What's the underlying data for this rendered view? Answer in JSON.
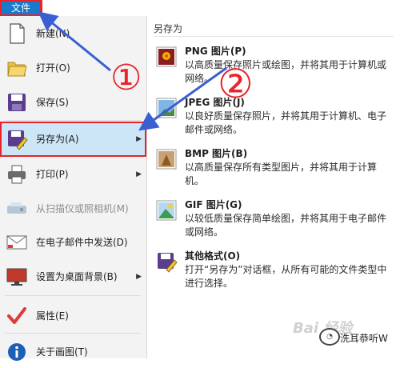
{
  "file_tab": {
    "label": "文件"
  },
  "menu": {
    "items": [
      {
        "label": "新建(N)",
        "icon": "new-document-icon"
      },
      {
        "label": "打开(O)",
        "icon": "open-folder-icon"
      },
      {
        "label": "保存(S)",
        "icon": "save-disk-icon"
      },
      {
        "label": "另存为(A)",
        "icon": "save-as-icon",
        "has_submenu": true,
        "active": true
      },
      {
        "label": "打印(P)",
        "icon": "printer-icon",
        "has_submenu": true
      },
      {
        "label": "从扫描仪或照相机(M)",
        "icon": "scanner-icon",
        "disabled": true
      },
      {
        "label": "在电子邮件中发送(D)",
        "icon": "email-icon"
      },
      {
        "label": "设置为桌面背景(B)",
        "icon": "desktop-background-icon",
        "has_submenu": true
      },
      {
        "label": "属性(E)",
        "icon": "checkmark-icon"
      },
      {
        "label": "关于画图(T)",
        "icon": "about-icon"
      }
    ],
    "submenu_arrow": "▶"
  },
  "save_as_panel": {
    "header": "另存为",
    "formats": [
      {
        "title": "PNG 图片(P)",
        "desc": "以高质量保存照片或绘图，并将其用于计算机或网络。",
        "icon": "png-image-icon"
      },
      {
        "title": "JPEG 图片(J)",
        "desc": "以良好质量保存照片，并将其用于计算机、电子邮件或网络。",
        "icon": "jpeg-image-icon"
      },
      {
        "title": "BMP 图片(B)",
        "desc": "以高质量保存所有类型图片，并将其用于计算机。",
        "icon": "bmp-image-icon"
      },
      {
        "title": "GIF 图片(G)",
        "desc": "以较低质量保存简单绘图，并将其用于电子邮件或网络。",
        "icon": "gif-image-icon"
      },
      {
        "title": "其他格式(O)",
        "desc": "打开“另存为”对话框，从所有可能的文件类型中进行选择。",
        "icon": "other-formats-icon"
      }
    ]
  },
  "annotations": {
    "step1": "①",
    "step2": "②"
  },
  "watermark": {
    "text": "洗耳恭听W",
    "brand": "Bai 经验"
  },
  "colors": {
    "file_tab": "#1979ca",
    "highlight_box": "#e8232a",
    "arrow": "#3a5fd0",
    "active_item": "#cde6f7"
  }
}
